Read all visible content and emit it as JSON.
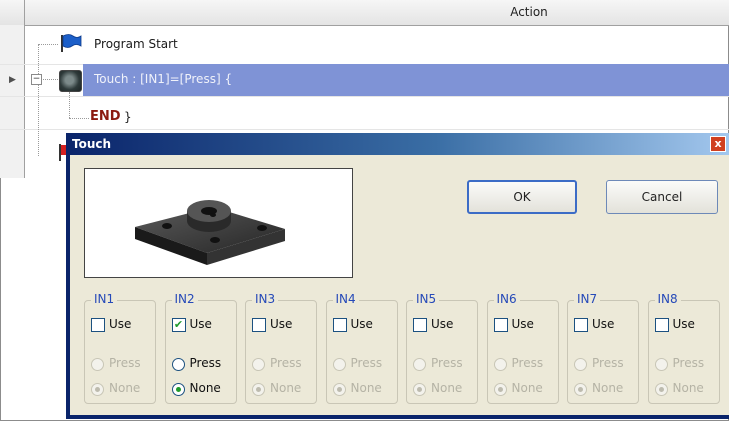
{
  "grid": {
    "column_header": "Action"
  },
  "tree": {
    "program_start": "Program Start",
    "touch_node": "Touch : [IN1]=[Press] {",
    "end_label": "END",
    "close_brace": "}"
  },
  "dialog": {
    "title": "Touch",
    "close_glyph": "x",
    "ok_label": "OK",
    "cancel_label": "Cancel",
    "inputs": [
      {
        "label": "IN1",
        "use_label": "Use",
        "use_checked": false,
        "press_label": "Press",
        "none_label": "None",
        "selected": "none",
        "enabled": false
      },
      {
        "label": "IN2",
        "use_label": "Use",
        "use_checked": true,
        "press_label": "Press",
        "none_label": "None",
        "selected": "none",
        "enabled": true
      },
      {
        "label": "IN3",
        "use_label": "Use",
        "use_checked": false,
        "press_label": "Press",
        "none_label": "None",
        "selected": "none",
        "enabled": false
      },
      {
        "label": "IN4",
        "use_label": "Use",
        "use_checked": false,
        "press_label": "Press",
        "none_label": "None",
        "selected": "none",
        "enabled": false
      },
      {
        "label": "IN5",
        "use_label": "Use",
        "use_checked": false,
        "press_label": "Press",
        "none_label": "None",
        "selected": "none",
        "enabled": false
      },
      {
        "label": "IN6",
        "use_label": "Use",
        "use_checked": false,
        "press_label": "Press",
        "none_label": "None",
        "selected": "none",
        "enabled": false
      },
      {
        "label": "IN7",
        "use_label": "Use",
        "use_checked": false,
        "press_label": "Press",
        "none_label": "None",
        "selected": "none",
        "enabled": false
      },
      {
        "label": "IN8",
        "use_label": "Use",
        "use_checked": false,
        "press_label": "Press",
        "none_label": "None",
        "selected": "none",
        "enabled": false
      }
    ]
  },
  "colors": {
    "selected_row": "#7f93d6",
    "dialog_face": "#ece9d8",
    "group_label": "#2549b8",
    "check_green": "#1f9a2c",
    "end_text": "#8b1a10"
  },
  "icons": [
    "flag-icon",
    "touch-sensor-icon",
    "expander-icon",
    "row-arrow-icon",
    "close-icon"
  ]
}
